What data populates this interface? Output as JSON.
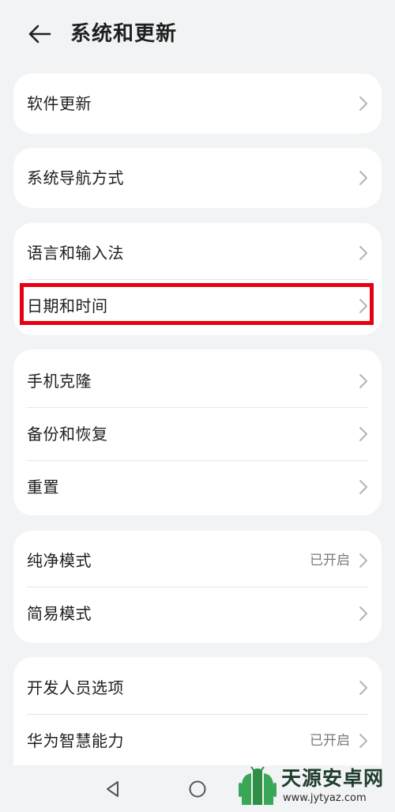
{
  "header": {
    "title": "系统和更新"
  },
  "cards": [
    {
      "items": [
        {
          "label": "软件更新"
        }
      ]
    },
    {
      "items": [
        {
          "label": "系统导航方式"
        }
      ]
    },
    {
      "items": [
        {
          "label": "语言和输入法"
        },
        {
          "label": "日期和时间"
        }
      ]
    },
    {
      "items": [
        {
          "label": "手机克隆"
        },
        {
          "label": "备份和恢复"
        },
        {
          "label": "重置"
        }
      ]
    },
    {
      "items": [
        {
          "label": "纯净模式",
          "status": "已开启"
        },
        {
          "label": "简易模式"
        }
      ]
    },
    {
      "items": [
        {
          "label": "开发人员选项"
        },
        {
          "label": "华为智慧能力",
          "status": "已开启"
        }
      ]
    }
  ],
  "highlight": {
    "color": "#e60012"
  },
  "watermark": {
    "title": "天源安卓网",
    "url": "www.jytyaz.com"
  }
}
